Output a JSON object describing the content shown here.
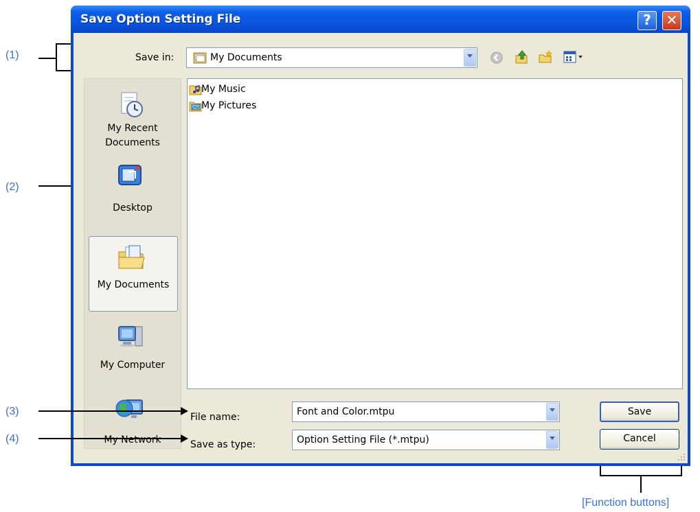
{
  "dialog": {
    "title": "Save Option Setting File",
    "help_button": "?",
    "close_button": "✕"
  },
  "toolbar": {
    "save_in_label": "Save in:",
    "save_in_value": "My Documents",
    "icons": [
      "back-icon",
      "up-folder-icon",
      "new-folder-icon",
      "view-menu-icon"
    ]
  },
  "places": [
    {
      "label": "My Recent Documents",
      "lines": [
        "My Recent",
        "Documents"
      ],
      "icon": "recent-documents-icon"
    },
    {
      "label": "Desktop",
      "lines": [
        "Desktop"
      ],
      "icon": "desktop-icon"
    },
    {
      "label": "My Documents",
      "lines": [
        "My Documents"
      ],
      "icon": "my-documents-icon",
      "selected": true
    },
    {
      "label": "My Computer",
      "lines": [
        "My Computer"
      ],
      "icon": "my-computer-icon"
    },
    {
      "label": "My Network",
      "lines": [
        "My Network"
      ],
      "icon": "my-network-icon"
    }
  ],
  "files": [
    {
      "name": "My Music",
      "icon": "music-folder-icon"
    },
    {
      "name": "My Pictures",
      "icon": "pictures-folder-icon"
    }
  ],
  "form": {
    "file_name_label": "File name:",
    "file_name_value": "Font and Color.mtpu",
    "save_as_type_label": "Save as type:",
    "save_as_type_value": "Option Setting File (*.mtpu)"
  },
  "buttons": {
    "save": "Save",
    "cancel": "Cancel"
  },
  "annotations": {
    "c1": "(1)",
    "c2": "(2)",
    "c3": "(3)",
    "c4": "(4)",
    "function_buttons": "[Function buttons]"
  },
  "colors": {
    "titlebar": "#0a52dc",
    "dialog_face": "#ece9d8",
    "annotation_text": "#3a6fd8"
  }
}
